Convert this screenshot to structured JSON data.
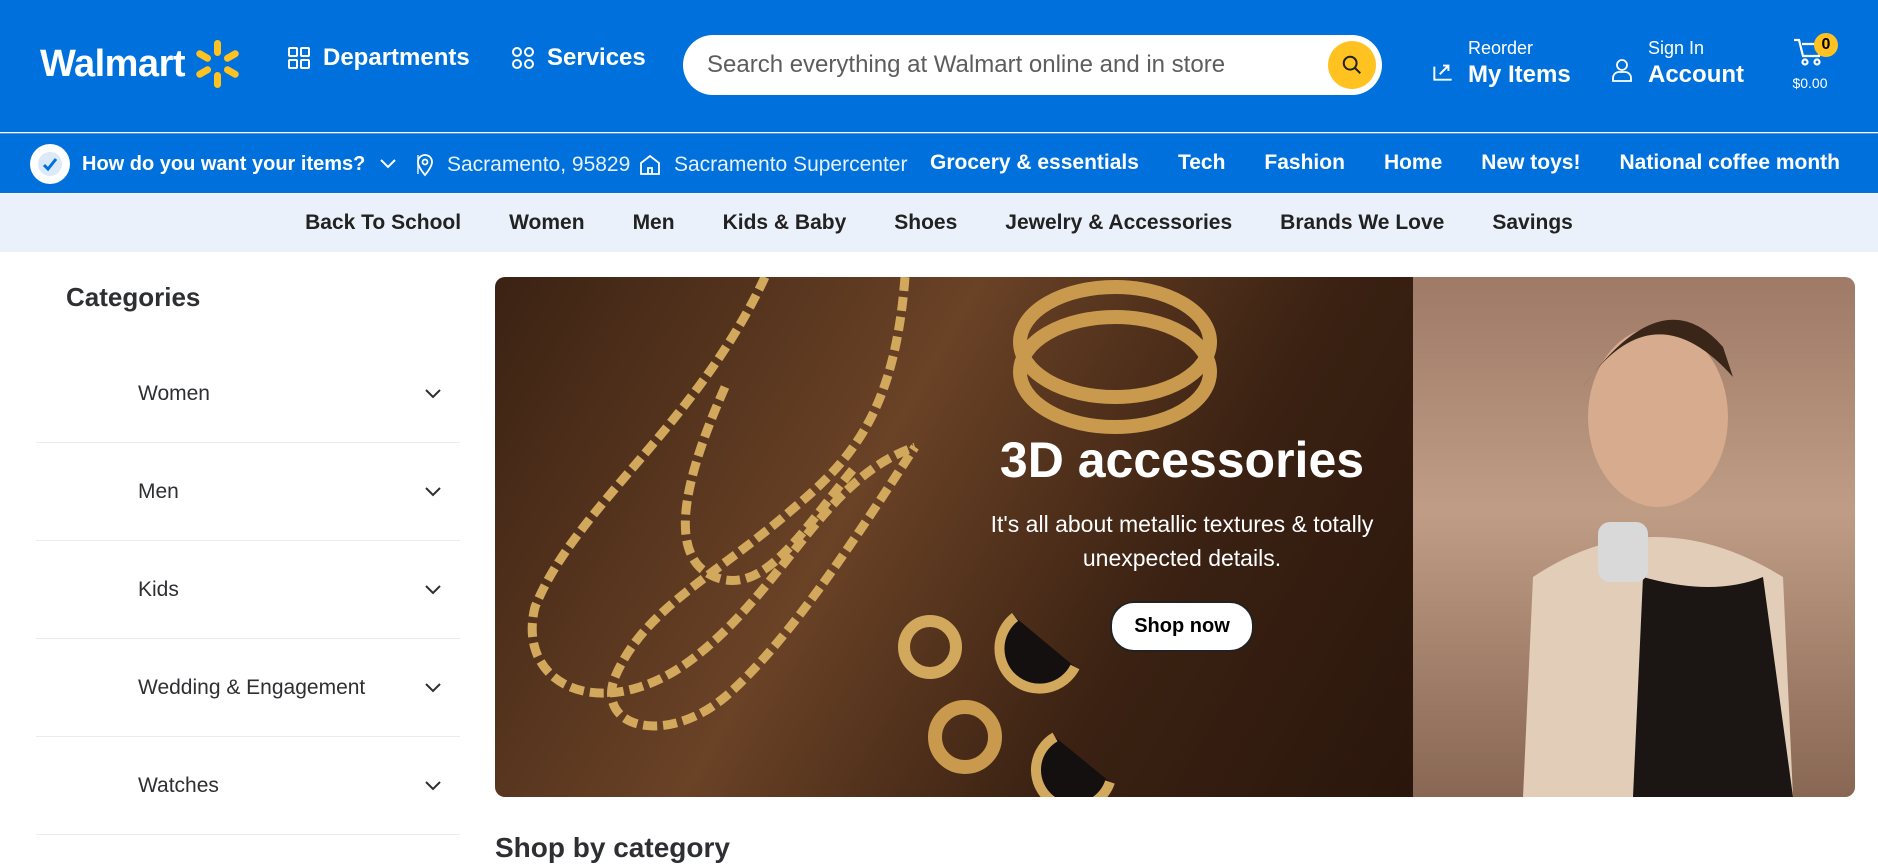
{
  "header": {
    "logo_text": "Walmart",
    "departments_label": "Departments",
    "services_label": "Services",
    "search_placeholder": "Search everything at Walmart online and in store",
    "reorder_small": "Reorder",
    "reorder_big": "My Items",
    "signin_small": "Sign In",
    "signin_big": "Account",
    "cart_count": "0",
    "cart_total": "$0.00",
    "brand_color": "#0071dc",
    "accent_color": "#ffc220"
  },
  "subbar": {
    "fulfillment_label": "How do you want your items?",
    "separator": "|",
    "zip": "Sacramento, 95829",
    "store": "Sacramento Supercenter",
    "links": [
      "Grocery & essentials",
      "Tech",
      "Fashion",
      "Home",
      "New toys!",
      "National coffee month"
    ]
  },
  "catbar": {
    "items": [
      "Back To School",
      "Women",
      "Men",
      "Kids & Baby",
      "Shoes",
      "Jewelry & Accessories",
      "Brands We Love",
      "Savings"
    ]
  },
  "sidebar": {
    "title": "Categories",
    "items": [
      "Women",
      "Men",
      "Kids",
      "Wedding & Engagement",
      "Watches"
    ]
  },
  "hero": {
    "title": "3D accessories",
    "subtitle": "It's all about metallic textures & totally unexpected details.",
    "cta": "Shop now"
  },
  "section": {
    "heading": "Shop by category"
  }
}
